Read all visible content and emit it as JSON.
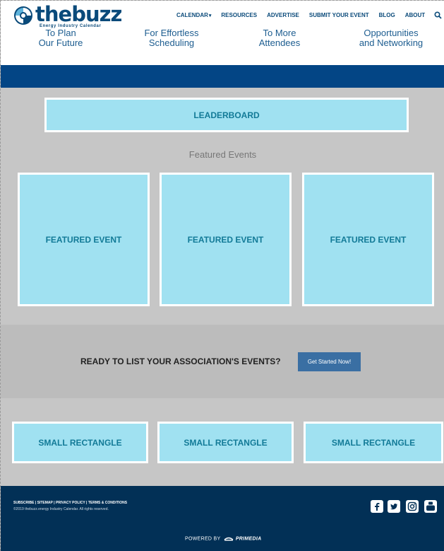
{
  "header": {
    "logo": {
      "name_left": "the",
      "name_right": "buzz",
      "tagline": "Energy Industry Calendar"
    },
    "nav": [
      {
        "label": "CALENDAR"
      },
      {
        "label": "RESOURCES"
      },
      {
        "label": "ADVERTISE"
      },
      {
        "label": "SUBMIT YOUR EVENT"
      },
      {
        "label": "BLOG"
      },
      {
        "label": "ABOUT"
      }
    ],
    "search_icon": "search-icon"
  },
  "benefits": [
    {
      "line1": "To Plan",
      "line2": "Our Future"
    },
    {
      "line1": "For Effortless",
      "line2": "Scheduling"
    },
    {
      "line1": "To More",
      "line2": "Attendees"
    },
    {
      "line1": "Opportunities",
      "line2": "and Networking"
    }
  ],
  "ads": {
    "leaderboard": "LEADERBOARD",
    "featured_title": "Featured Events",
    "featured": [
      "FEATURED EVENT",
      "FEATURED EVENT",
      "FEATURED EVENT"
    ],
    "small": [
      "SMALL RECTANGLE",
      "SMALL RECTANGLE",
      "SMALL RECTANGLE"
    ]
  },
  "cta": {
    "text": "READY TO LIST YOUR ASSOCIATION'S EVENTS?",
    "button": "Get Started Now!"
  },
  "footer": {
    "links": [
      "SUBSCRIBE",
      "SITEMAP",
      "PRIVACY POLICY",
      "TERMS & CONDITIONS"
    ],
    "copyright": "©2019 thebuzz.energy Industry Calendar. All rights reserved.",
    "powered_by": "POWERED BY",
    "powered_brand": "PRIMEDIA",
    "social": [
      "facebook-icon",
      "twitter-icon",
      "instagram-icon",
      "youtube-icon"
    ]
  },
  "colors": {
    "brand_blue": "#034585",
    "ad_fill": "#a0e1f1",
    "ad_text": "#127a97",
    "footer_bg": "#023056"
  }
}
